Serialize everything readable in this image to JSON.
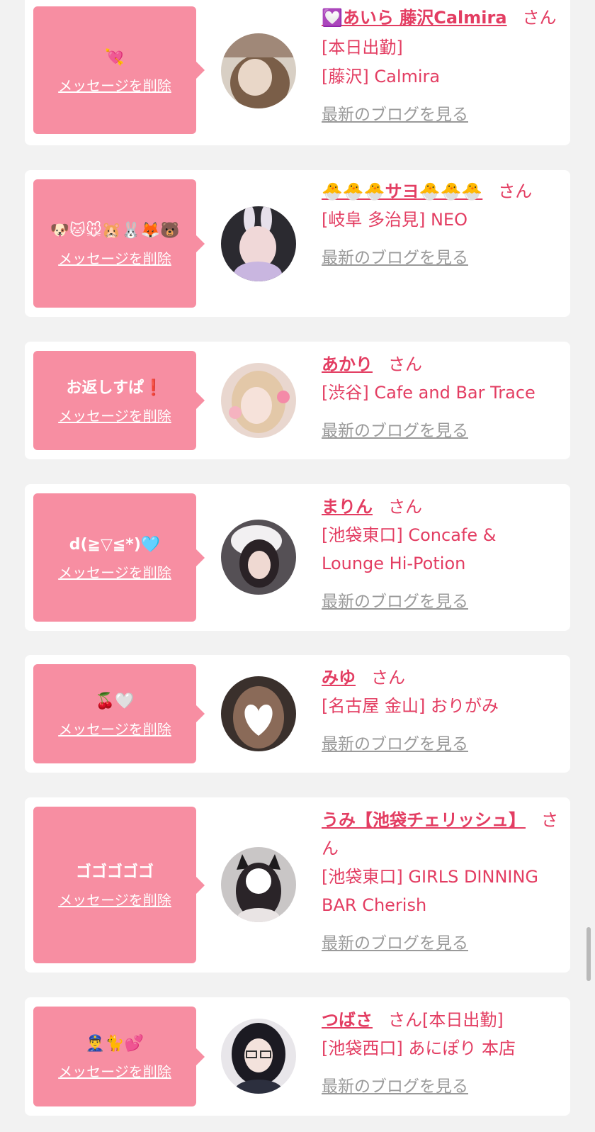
{
  "delete_label": "メッセージを削除",
  "san_label": "さん",
  "blog_label": "最新のブログを見る",
  "cards": [
    {
      "message": "💘",
      "name": "💟あいら 藤沢Calmira",
      "status": "[本日出勤]",
      "shop": "[藤沢] Calmira"
    },
    {
      "message": "🐶🐱🐭🐹🐰🦊🐻",
      "name": "🐣🐣🐣サヨ🐣🐣🐣",
      "status": "",
      "shop": "[岐阜 多治見] NEO"
    },
    {
      "message": "お返しすぱ❗️",
      "name": "あかり",
      "status": "",
      "shop": "[渋谷] Cafe and Bar Trace"
    },
    {
      "message": "d(≧▽≦*)🩵",
      "name": "まりん",
      "status": "",
      "shop": "[池袋東口] Concafe & Lounge Hi-Potion"
    },
    {
      "message": "🍒🤍",
      "name": "みゆ",
      "status": "",
      "shop": "[名古屋 金山] おりがみ"
    },
    {
      "message": "ゴゴゴゴゴ",
      "name": "うみ【池袋チェリッシュ】",
      "status": "",
      "shop": "[池袋東口] GIRLS DINNING BAR Cherish"
    },
    {
      "message": "👮‍♂️🐈💕",
      "name": "つばさ",
      "status": "[本日出勤]",
      "shop": "[池袋西口] あにぽり 本店"
    }
  ],
  "colors": {
    "accent": "#e33d62",
    "bubble": "#f78ea2",
    "link_gray": "#9a9a9a",
    "background": "#f2f2f2"
  }
}
